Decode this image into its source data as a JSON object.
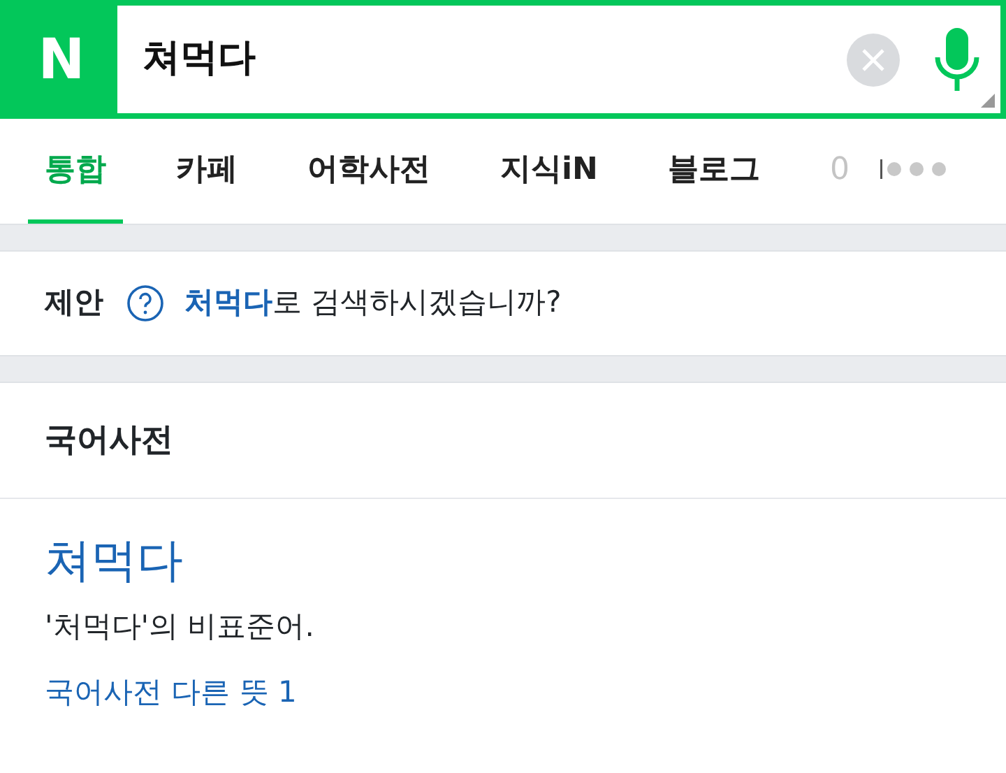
{
  "search": {
    "logo": "N",
    "value": "쳐먹다"
  },
  "tabs": [
    {
      "label": "통합",
      "selected": true
    },
    {
      "label": "카페",
      "selected": false
    },
    {
      "label": "어학사전",
      "selected": false
    },
    {
      "label": "지식iN",
      "selected": false
    },
    {
      "label": "블로그",
      "selected": false
    },
    {
      "label": "0",
      "selected": false,
      "faded": true
    }
  ],
  "suggestion": {
    "label": "제안",
    "query": "처먹다",
    "rest": "로 검색하시겠습니까?"
  },
  "dictionary": {
    "title": "국어사전",
    "word": "쳐먹다",
    "definition": "'처먹다'의 비표준어.",
    "more_link": "국어사전 다른 뜻 1"
  }
}
